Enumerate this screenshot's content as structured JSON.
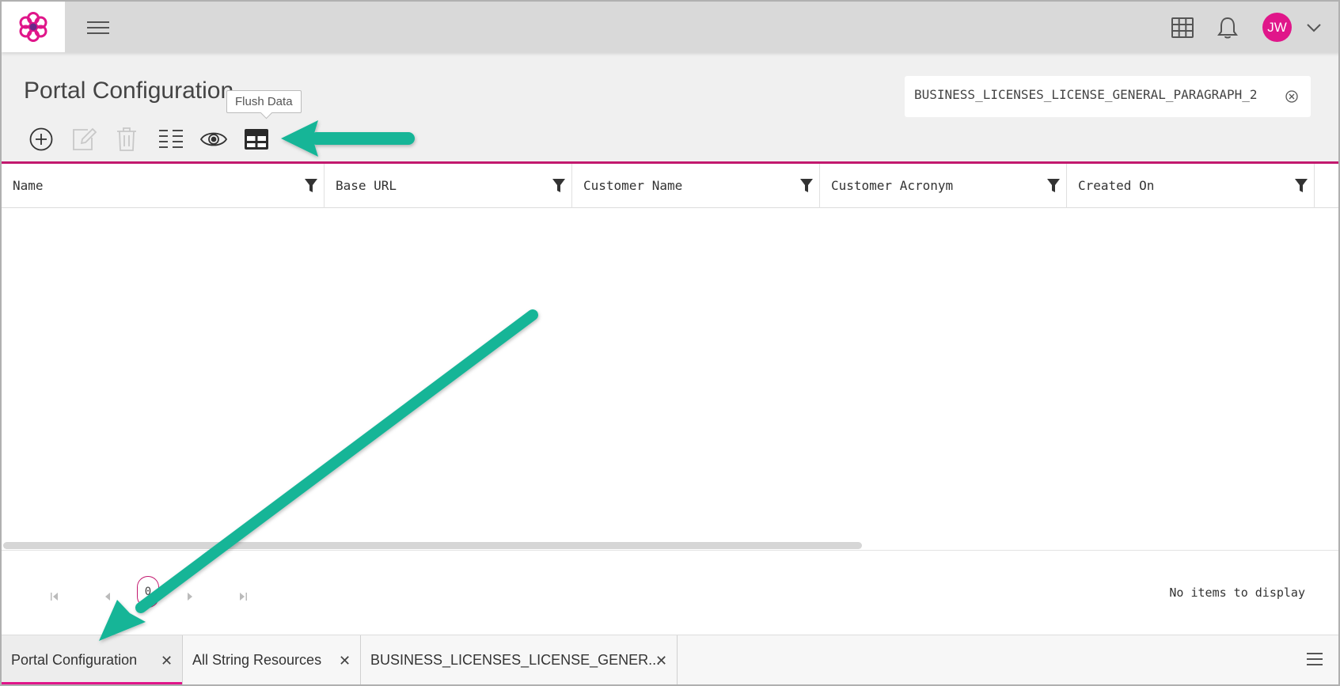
{
  "app": {
    "logo": "flower-logo",
    "user_initials": "JW",
    "colors": {
      "brand": "#e0168a",
      "accent_line": "#c2186e",
      "annotation": "#13b597"
    }
  },
  "header": {
    "page_title": "Portal Configuration",
    "search": {
      "value": "BUSINESS_LICENSES_LICENSE_GENERAL_PARAGRAPH_2"
    }
  },
  "toolbar": {
    "tooltip": "Flush Data",
    "buttons": [
      {
        "icon": "add-circle-icon",
        "enabled": true
      },
      {
        "icon": "edit-icon",
        "enabled": false
      },
      {
        "icon": "trash-icon",
        "enabled": false
      },
      {
        "icon": "list-columns-icon",
        "enabled": true
      },
      {
        "icon": "eye-icon",
        "enabled": true
      },
      {
        "icon": "table-icon",
        "enabled": true
      }
    ]
  },
  "grid": {
    "columns": [
      "Name",
      "Base URL",
      "Customer Name",
      "Customer Acronym",
      "Created On"
    ],
    "rows": []
  },
  "pager": {
    "current_page": "0",
    "status": "No items to display"
  },
  "tabs": [
    {
      "label": "Portal Configuration",
      "active": true
    },
    {
      "label": "All String Resources",
      "active": false
    },
    {
      "label": "BUSINESS_LICENSES_LICENSE_GENER...",
      "active": false
    }
  ]
}
